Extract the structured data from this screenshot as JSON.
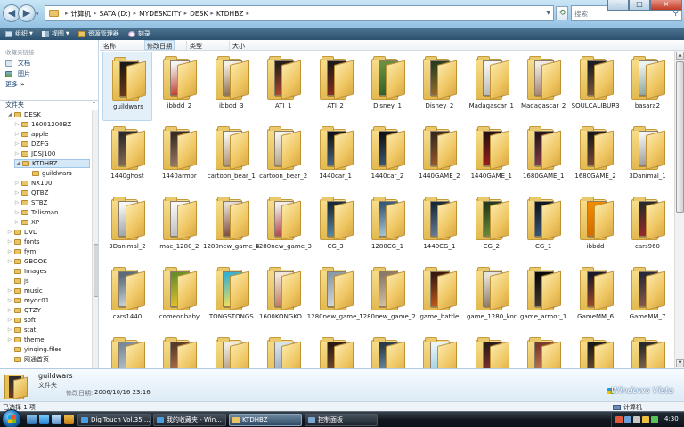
{
  "window": {
    "breadcrumbs": [
      "计算机",
      "SATA (D:)",
      "MYDESKCITY",
      "DESK",
      "KTDHBZ"
    ],
    "search_placeholder": "搜索",
    "controls": {
      "minimize": "–",
      "maximize": "□",
      "close": "×"
    }
  },
  "toolbar": {
    "organize": "组织",
    "views": "视图",
    "explorer": "资源管理器",
    "burn": "刻录"
  },
  "favorites": {
    "heading": "收藏夹链接",
    "items": [
      "文档",
      "图片",
      "更多"
    ],
    "more_chevron": "»"
  },
  "folders_pane": {
    "heading": "文件夹",
    "items": [
      {
        "label": "DESK",
        "arrow": "◢",
        "level": 0
      },
      {
        "label": "16001200BZ",
        "arrow": "▷",
        "level": 1
      },
      {
        "label": "apple",
        "arrow": "▷",
        "level": 1
      },
      {
        "label": "DZFG",
        "arrow": "▷",
        "level": 1
      },
      {
        "label": "JDSJ100",
        "arrow": "▷",
        "level": 1
      },
      {
        "label": "KTDHBZ",
        "arrow": "◢",
        "level": 1,
        "selected": true
      },
      {
        "label": "guildwars",
        "arrow": "",
        "level": 2
      },
      {
        "label": "NX100",
        "arrow": "▷",
        "level": 1
      },
      {
        "label": "QTBZ",
        "arrow": "▷",
        "level": 1
      },
      {
        "label": "STBZ",
        "arrow": "▷",
        "level": 1
      },
      {
        "label": "Talisman",
        "arrow": "▷",
        "level": 1
      },
      {
        "label": "XP",
        "arrow": "▷",
        "level": 1
      },
      {
        "label": "DVD",
        "arrow": "▷",
        "level": 0
      },
      {
        "label": "fonts",
        "arrow": "▷",
        "level": 0
      },
      {
        "label": "fym",
        "arrow": "▷",
        "level": 0
      },
      {
        "label": "GBOOK",
        "arrow": "▷",
        "level": 0
      },
      {
        "label": "Images",
        "arrow": "",
        "level": 0
      },
      {
        "label": "js",
        "arrow": "",
        "level": 0
      },
      {
        "label": "music",
        "arrow": "▷",
        "level": 0
      },
      {
        "label": "mydc01",
        "arrow": "▷",
        "level": 0
      },
      {
        "label": "QTZY",
        "arrow": "▷",
        "level": 0
      },
      {
        "label": "soft",
        "arrow": "▷",
        "level": 0
      },
      {
        "label": "stat",
        "arrow": "▷",
        "level": 0
      },
      {
        "label": "theme",
        "arrow": "▷",
        "level": 0
      },
      {
        "label": "yinqing.files",
        "arrow": "",
        "level": 0
      },
      {
        "label": "网通首页",
        "arrow": "",
        "level": 0
      }
    ]
  },
  "columns": [
    "名称",
    "修改日期",
    "类型",
    "大小"
  ],
  "files": [
    "guildwars",
    "ibbdd_2",
    "ibbdd_3",
    "ATI_1",
    "ATI_2",
    "Disney_1",
    "Disney_2",
    "Madagascar_1",
    "Madagascar_2",
    "SOULCALIBUR3",
    "basara2",
    "1440ghost",
    "1440armor",
    "cartoon_bear_1",
    "cartoon_bear_2",
    "1440car_1",
    "1440car_2",
    "1440GAME_2",
    "1440GAME_1",
    "1680GAME_1",
    "1680GAME_2",
    "3Danimal_1",
    "3Danimal_2",
    "mac_1280_2",
    "1280new_game_4",
    "1280new_game_3",
    "CG_3",
    "1280CG_1",
    "1440CG_1",
    "CG_2",
    "CG_1",
    "ibbdd",
    "cars960",
    "cars1440",
    "comeonbaby",
    "TONGSTONGS",
    "1600KONGKO...",
    "1280new_game_1",
    "1280new_game_2",
    "game_battle",
    "game_1280_kor",
    "game_armor_1",
    "GameMM_6",
    "GameMM_7",
    "",
    "",
    "",
    "",
    "",
    "",
    "",
    "",
    "",
    "",
    ""
  ],
  "thumb_colors": [
    [
      "#1d1a14",
      "#6b3b1c"
    ],
    [
      "#f4f4f4",
      "#c0392b"
    ],
    [
      "#f6f1e6",
      "#8a6c4b"
    ],
    [
      "#2a1c18",
      "#b24d2e"
    ],
    [
      "#1e1a1a",
      "#8c2f1f"
    ],
    [
      "#6a8f3f",
      "#2f5f2a"
    ],
    [
      "#2b3d1e",
      "#9b6e2c"
    ],
    [
      "#f5f5f5",
      "#b8b8b8"
    ],
    [
      "#f0ece2",
      "#a5806a"
    ],
    [
      "#1c1c22",
      "#7b5a3d"
    ],
    [
      "#eef3f0",
      "#8aa39a"
    ],
    [
      "#2d2a28",
      "#876b55"
    ],
    [
      "#3a2c22",
      "#9b7b62"
    ],
    [
      "#f7f5ef",
      "#a99070"
    ],
    [
      "#f5f2ea",
      "#b5a080"
    ],
    [
      "#101418",
      "#4a6a8a"
    ],
    [
      "#0f141a",
      "#3c5876"
    ],
    [
      "#3a2a1d",
      "#9a5a2a"
    ],
    [
      "#2a1010",
      "#a01f1f"
    ],
    [
      "#2a1416",
      "#8a3f4a"
    ],
    [
      "#1a1a1a",
      "#7a4a3a"
    ],
    [
      "#f3f3f3",
      "#9a9a9a"
    ],
    [
      "#f6f6f6",
      "#9aa2a8"
    ],
    [
      "#f7f7f7",
      "#bcbcbc"
    ],
    [
      "#e5ddd2",
      "#7a4a3a"
    ],
    [
      "#f2eee6",
      "#b0414a"
    ],
    [
      "#1a2a3a",
      "#5a8aa8"
    ],
    [
      "#3a5a7a",
      "#a9c8d8"
    ],
    [
      "#1a2a3a",
      "#6a8098"
    ],
    [
      "#253a1c",
      "#6a8f3a"
    ],
    [
      "#101820",
      "#3a5a7a"
    ],
    [
      "#f28a00",
      "#d26a00"
    ],
    [
      "#2a2a2a",
      "#9a2a2a"
    ],
    [
      "#5a6a7a",
      "#c8d2da"
    ],
    [
      "#6a8f2a",
      "#e2c02a"
    ],
    [
      "#3ab0d0",
      "#f0e05a"
    ],
    [
      "#f2e6da",
      "#c07a5a"
    ],
    [
      "#8a9aa8",
      "#d0d8e0"
    ],
    [
      "#8a7a6a",
      "#d0c0a8"
    ],
    [
      "#3a1a10",
      "#c05a1a"
    ],
    [
      "#e8e4dc",
      "#8a7a6a"
    ],
    [
      "#0a0a0a",
      "#4a3a2a"
    ],
    [
      "#1a1a2a",
      "#a04a2a"
    ],
    [
      "#2a2a3a",
      "#8a5a4a"
    ],
    [
      "#7a8a9a",
      "#c0ccd6"
    ],
    [
      "#5a3a2a",
      "#c87a4a"
    ],
    [
      "#f0ece4",
      "#a08a6a"
    ],
    [
      "#d8e2ea",
      "#8aa0b8"
    ],
    [
      "#2a1a12",
      "#8a5a3a"
    ],
    [
      "#2a3a4a",
      "#7aa0c0"
    ],
    [
      "#e8f4f8",
      "#8ac8e0"
    ],
    [
      "#2a1a1a",
      "#9a3a3a"
    ],
    [
      "#7a3a2a",
      "#d08a5a"
    ],
    [
      "#1a1a1a",
      "#7a5a3a"
    ],
    [
      "#2a2a2a",
      "#9a7a5a"
    ]
  ],
  "details": {
    "name": "guildwars",
    "type": "文件夹",
    "modified_label": "修改日期:",
    "modified_value": "2006/10/16 23:16"
  },
  "status": {
    "count": "已选择 1 项",
    "location": "计算机"
  },
  "watermark": "Windows Vista",
  "taskbar": {
    "tasks": [
      "DigiTouch Vol.35 ...",
      "我的收藏夹 - Win...",
      "KTDHBZ",
      "控制面板"
    ],
    "clock": "4:30"
  },
  "colors": {
    "accent": "#2c5170",
    "selection": "#d5e8f7",
    "folder": "#e8c465"
  }
}
